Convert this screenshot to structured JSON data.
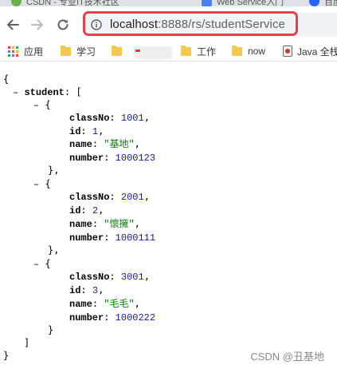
{
  "tabs": [
    {
      "label": "CSDN - 专业IT技术社区",
      "color": "#6ab04c"
    },
    {
      "label": "Web Service入门",
      "color": "#4a80f0"
    },
    {
      "label": "百度一下",
      "color": "#2962ff"
    }
  ],
  "address_bar": {
    "host": "localhost",
    "path": ":8888/rs/studentService"
  },
  "bookmarks": [
    {
      "label": "应用",
      "icon": "apps-icon"
    },
    {
      "label": "学习",
      "icon": "folder-icon"
    },
    {
      "label": "",
      "icon": "folder-icon"
    },
    {
      "label": "工作",
      "icon": "folder-icon"
    },
    {
      "label": "now",
      "icon": "folder-icon"
    },
    {
      "label": "Java 全栈",
      "icon": "java-icon"
    }
  ],
  "json_view": {
    "open_brace": "{",
    "close_brace": "}",
    "array_key": "student",
    "array_open": "[",
    "array_close": "]",
    "toggle": "–",
    "entry_open": "{",
    "entry_close": "},",
    "last_entry_close": "}",
    "students": [
      {
        "classNo": "1001",
        "id": "1",
        "name": "\"基地\"",
        "number": "1000123"
      },
      {
        "classNo": "2001",
        "id": "2",
        "name": "\"懷擁\"",
        "number": "1000111"
      },
      {
        "classNo": "3001",
        "id": "3",
        "name": "\"毛毛\"",
        "number": "1000222"
      }
    ],
    "labels": {
      "classNo": "classNo",
      "id": "id",
      "name": "name",
      "number": "number"
    }
  },
  "watermark": "CSDN @丑基地",
  "colors": {
    "highlight": "#e8414d",
    "number": "#1a1aa6",
    "string": "#0b7a0b"
  }
}
